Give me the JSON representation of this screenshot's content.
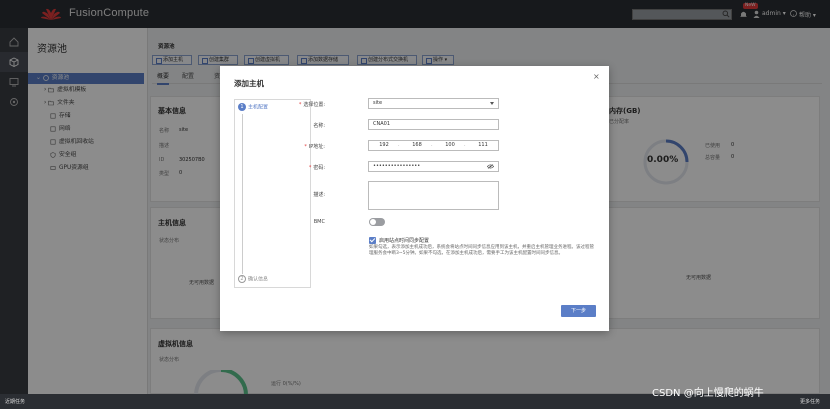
{
  "header": {
    "brand": "FusionCompute",
    "new_badge": "NeW",
    "user": "admin ▾",
    "help": "帮助 ▾"
  },
  "tree": {
    "title": "资源池",
    "items": [
      {
        "label": "资源池",
        "icon": "globe-icon",
        "level": 1,
        "selected": true
      },
      {
        "label": "虚拟机模板",
        "icon": "folder-icon",
        "level": 2
      },
      {
        "label": "文件夹",
        "icon": "folder-icon",
        "level": 2
      },
      {
        "label": "存储",
        "icon": "storage-icon",
        "level": 2
      },
      {
        "label": "网络",
        "icon": "network-icon",
        "level": 2
      },
      {
        "label": "虚拟机回收站",
        "icon": "recycle-icon",
        "level": 2
      },
      {
        "label": "安全组",
        "icon": "shield-icon",
        "level": 2
      },
      {
        "label": "GPU资源组",
        "icon": "gpu-icon",
        "level": 2
      }
    ]
  },
  "content": {
    "breadcrumb": "资源池",
    "toolbar": [
      "添加主机",
      "创建集群",
      "创建虚拟机",
      "添加数据存储",
      "创建分布式交换机",
      "操作 ▾"
    ],
    "tabs": [
      "概要",
      "配置",
      "资"
    ],
    "basic_info": {
      "title": "基本信息",
      "rows": [
        {
          "label": "名称",
          "value": "site"
        },
        {
          "label": "描述",
          "value": ""
        },
        {
          "label": "ID",
          "value": "302507B0"
        },
        {
          "label": "类型",
          "value": "0"
        }
      ]
    },
    "capacity_title": "内存(GB)",
    "capacity_sub": "已分配率",
    "capacity_value": "0.00%",
    "capacity_legend": [
      "已使用",
      "总容量"
    ],
    "capacity_legend_values": [
      "0",
      "0"
    ],
    "host_info": {
      "title": "主机信息",
      "sub": "状态分布",
      "no_data": "无可用数据"
    },
    "vm_info": {
      "title": "虚拟机信息",
      "sub": "状态分布",
      "legend": "运行 0(%/%)"
    }
  },
  "modal": {
    "title": "添加主机",
    "close": "×",
    "steps": [
      {
        "num": "1",
        "label": "主机配置"
      },
      {
        "num": "2",
        "label": "确认信息"
      }
    ],
    "fields": {
      "location_label": "选择位置:",
      "location_value": "site",
      "name_label": "名称:",
      "name_value": "CNA01",
      "ip_label": "IP地址:",
      "ip_segments": [
        "192",
        "168",
        "100",
        "111"
      ],
      "password_label": "密码:",
      "password_value": "••••••••••••••••",
      "desc_label": "描述:",
      "bmc_label": "BMC"
    },
    "ntp": {
      "label": "启用站点时间同步配置",
      "desc": "如果勾选，表示添加主机成功后，系统会将站点时间同步信息应用到该主机，并重启主机管理业务进程。该过程管理服务会中断3~5分钟。如果不勾选，在添加主机成功后，需要手工为该主机配置时间同步信息。"
    },
    "next": "下一步"
  },
  "footer": {
    "left": "近期任务",
    "right": "更多任务"
  },
  "watermark": "CSDN @向上慢爬的蜗牛",
  "colors": {
    "accent": "#5b7ec7",
    "topbar": "#2b2e33",
    "required": "#e03b3b"
  }
}
